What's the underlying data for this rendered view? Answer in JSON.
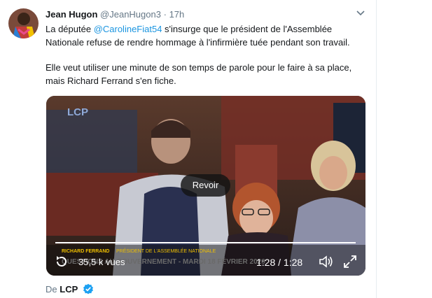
{
  "tweet": {
    "author_name": "Jean Hugon",
    "author_handle": "@JeanHugon3",
    "separator": "·",
    "time": "17h",
    "text_line1_before": "La députée ",
    "mention": "@CarolineFiat54",
    "text_line1_after": " s'insurge que le président de l'Assemblée Nationale refuse de rendre hommage à l'infirmière tuée pendant son travail.",
    "text_paragraph2": "Elle veut utiliser une minute de son temps de parole pour le faire à sa place, mais Richard Ferrand s'en fiche."
  },
  "video": {
    "channel_logo": "LCP",
    "lower_third_name": "RICHARD FERRAND",
    "lower_third_role": "PRÉSIDENT DE L'ASSEMBLÉE NATIONALE",
    "ticker": "QUESTIONS AU GOUVERNEMENT - MARDI 18 FÉVRIER 2020",
    "replay_label": "Revoir",
    "views": "35,5 k vues",
    "time_display": "1:28 / 1:28",
    "progress": 1.0
  },
  "source": {
    "label": "De",
    "account": "LCP"
  },
  "colors": {
    "link": "#1b95e0",
    "verified": "#1da1f2",
    "muted": "#657786"
  },
  "icons": [
    "chevron-down-icon",
    "replay-icon",
    "volume-icon",
    "fullscreen-icon",
    "verified-badge-icon"
  ]
}
